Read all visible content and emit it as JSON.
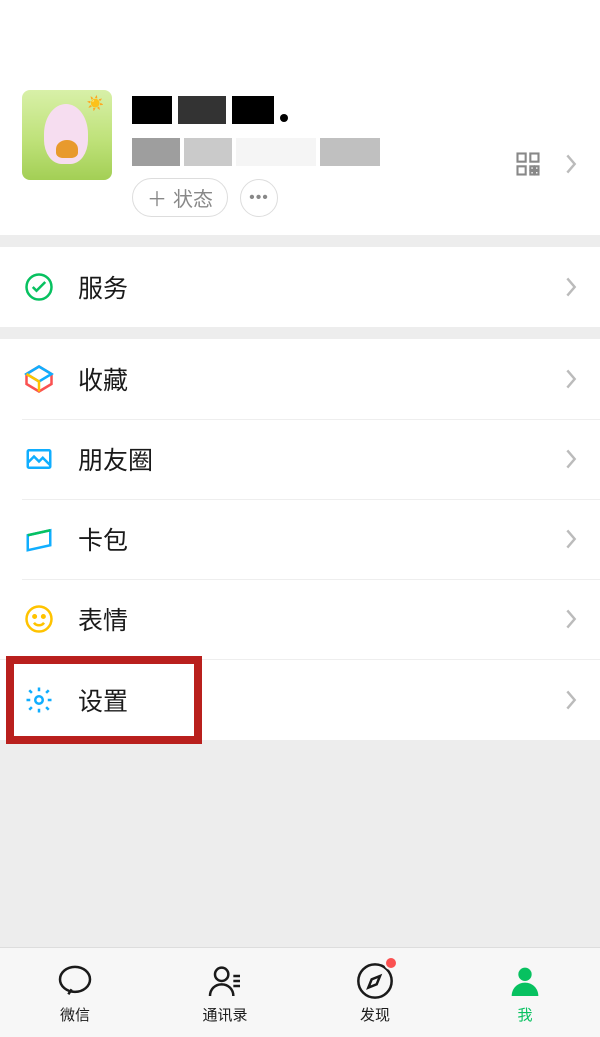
{
  "profile": {
    "status_label": "状态"
  },
  "menu": {
    "services": "服务",
    "favorites": "收藏",
    "moments": "朋友圈",
    "cards": "卡包",
    "stickers": "表情",
    "settings": "设置"
  },
  "tabs": {
    "chats": "微信",
    "contacts": "通讯录",
    "discover": "发现",
    "me": "我"
  },
  "highlight_target": "settings"
}
